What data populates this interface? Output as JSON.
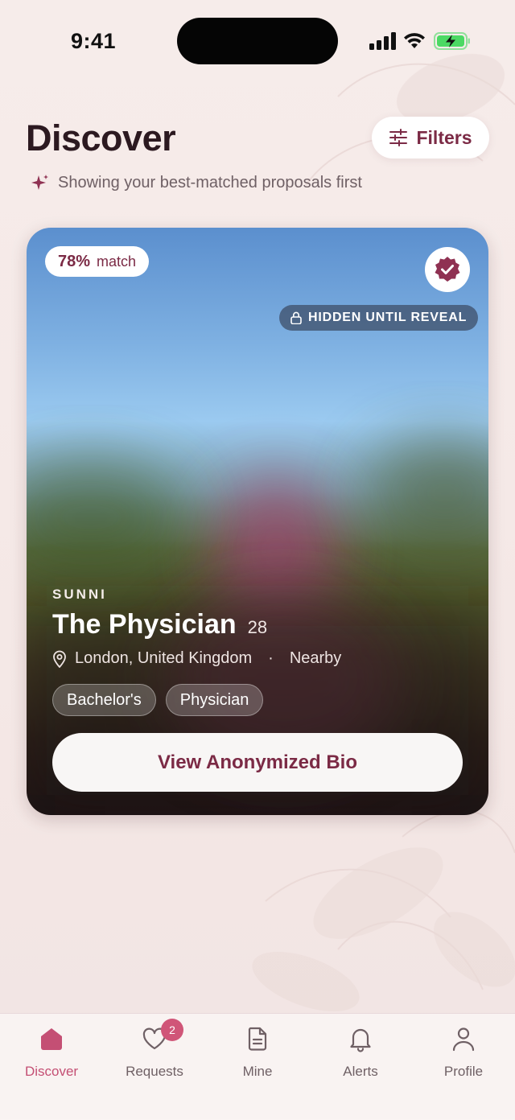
{
  "status_bar": {
    "time": "9:41"
  },
  "header": {
    "title": "Discover",
    "filters_label": "Filters",
    "subtitle": "Showing your best-matched proposals first"
  },
  "card": {
    "match_percent": "78%",
    "match_word": "match",
    "hidden_label": "HIDDEN UNTIL REVEAL",
    "community": "SUNNI",
    "name": "The Physician",
    "age": "28",
    "location": "London, United Kingdom",
    "separator": "·",
    "proximity": "Nearby",
    "tags": [
      "Bachelor's",
      "Physician"
    ],
    "cta": "View Anonymized Bio"
  },
  "tabbar": {
    "items": [
      {
        "label": "Discover",
        "icon": "home-icon",
        "active": true
      },
      {
        "label": "Requests",
        "icon": "heart-icon",
        "badge": "2"
      },
      {
        "label": "Mine",
        "icon": "document-icon"
      },
      {
        "label": "Alerts",
        "icon": "bell-icon"
      },
      {
        "label": "Profile",
        "icon": "person-icon"
      }
    ]
  },
  "colors": {
    "accent": "#7b2a45",
    "active_tab": "#c44f74",
    "badge": "#d05578",
    "battery": "#4cd964"
  }
}
